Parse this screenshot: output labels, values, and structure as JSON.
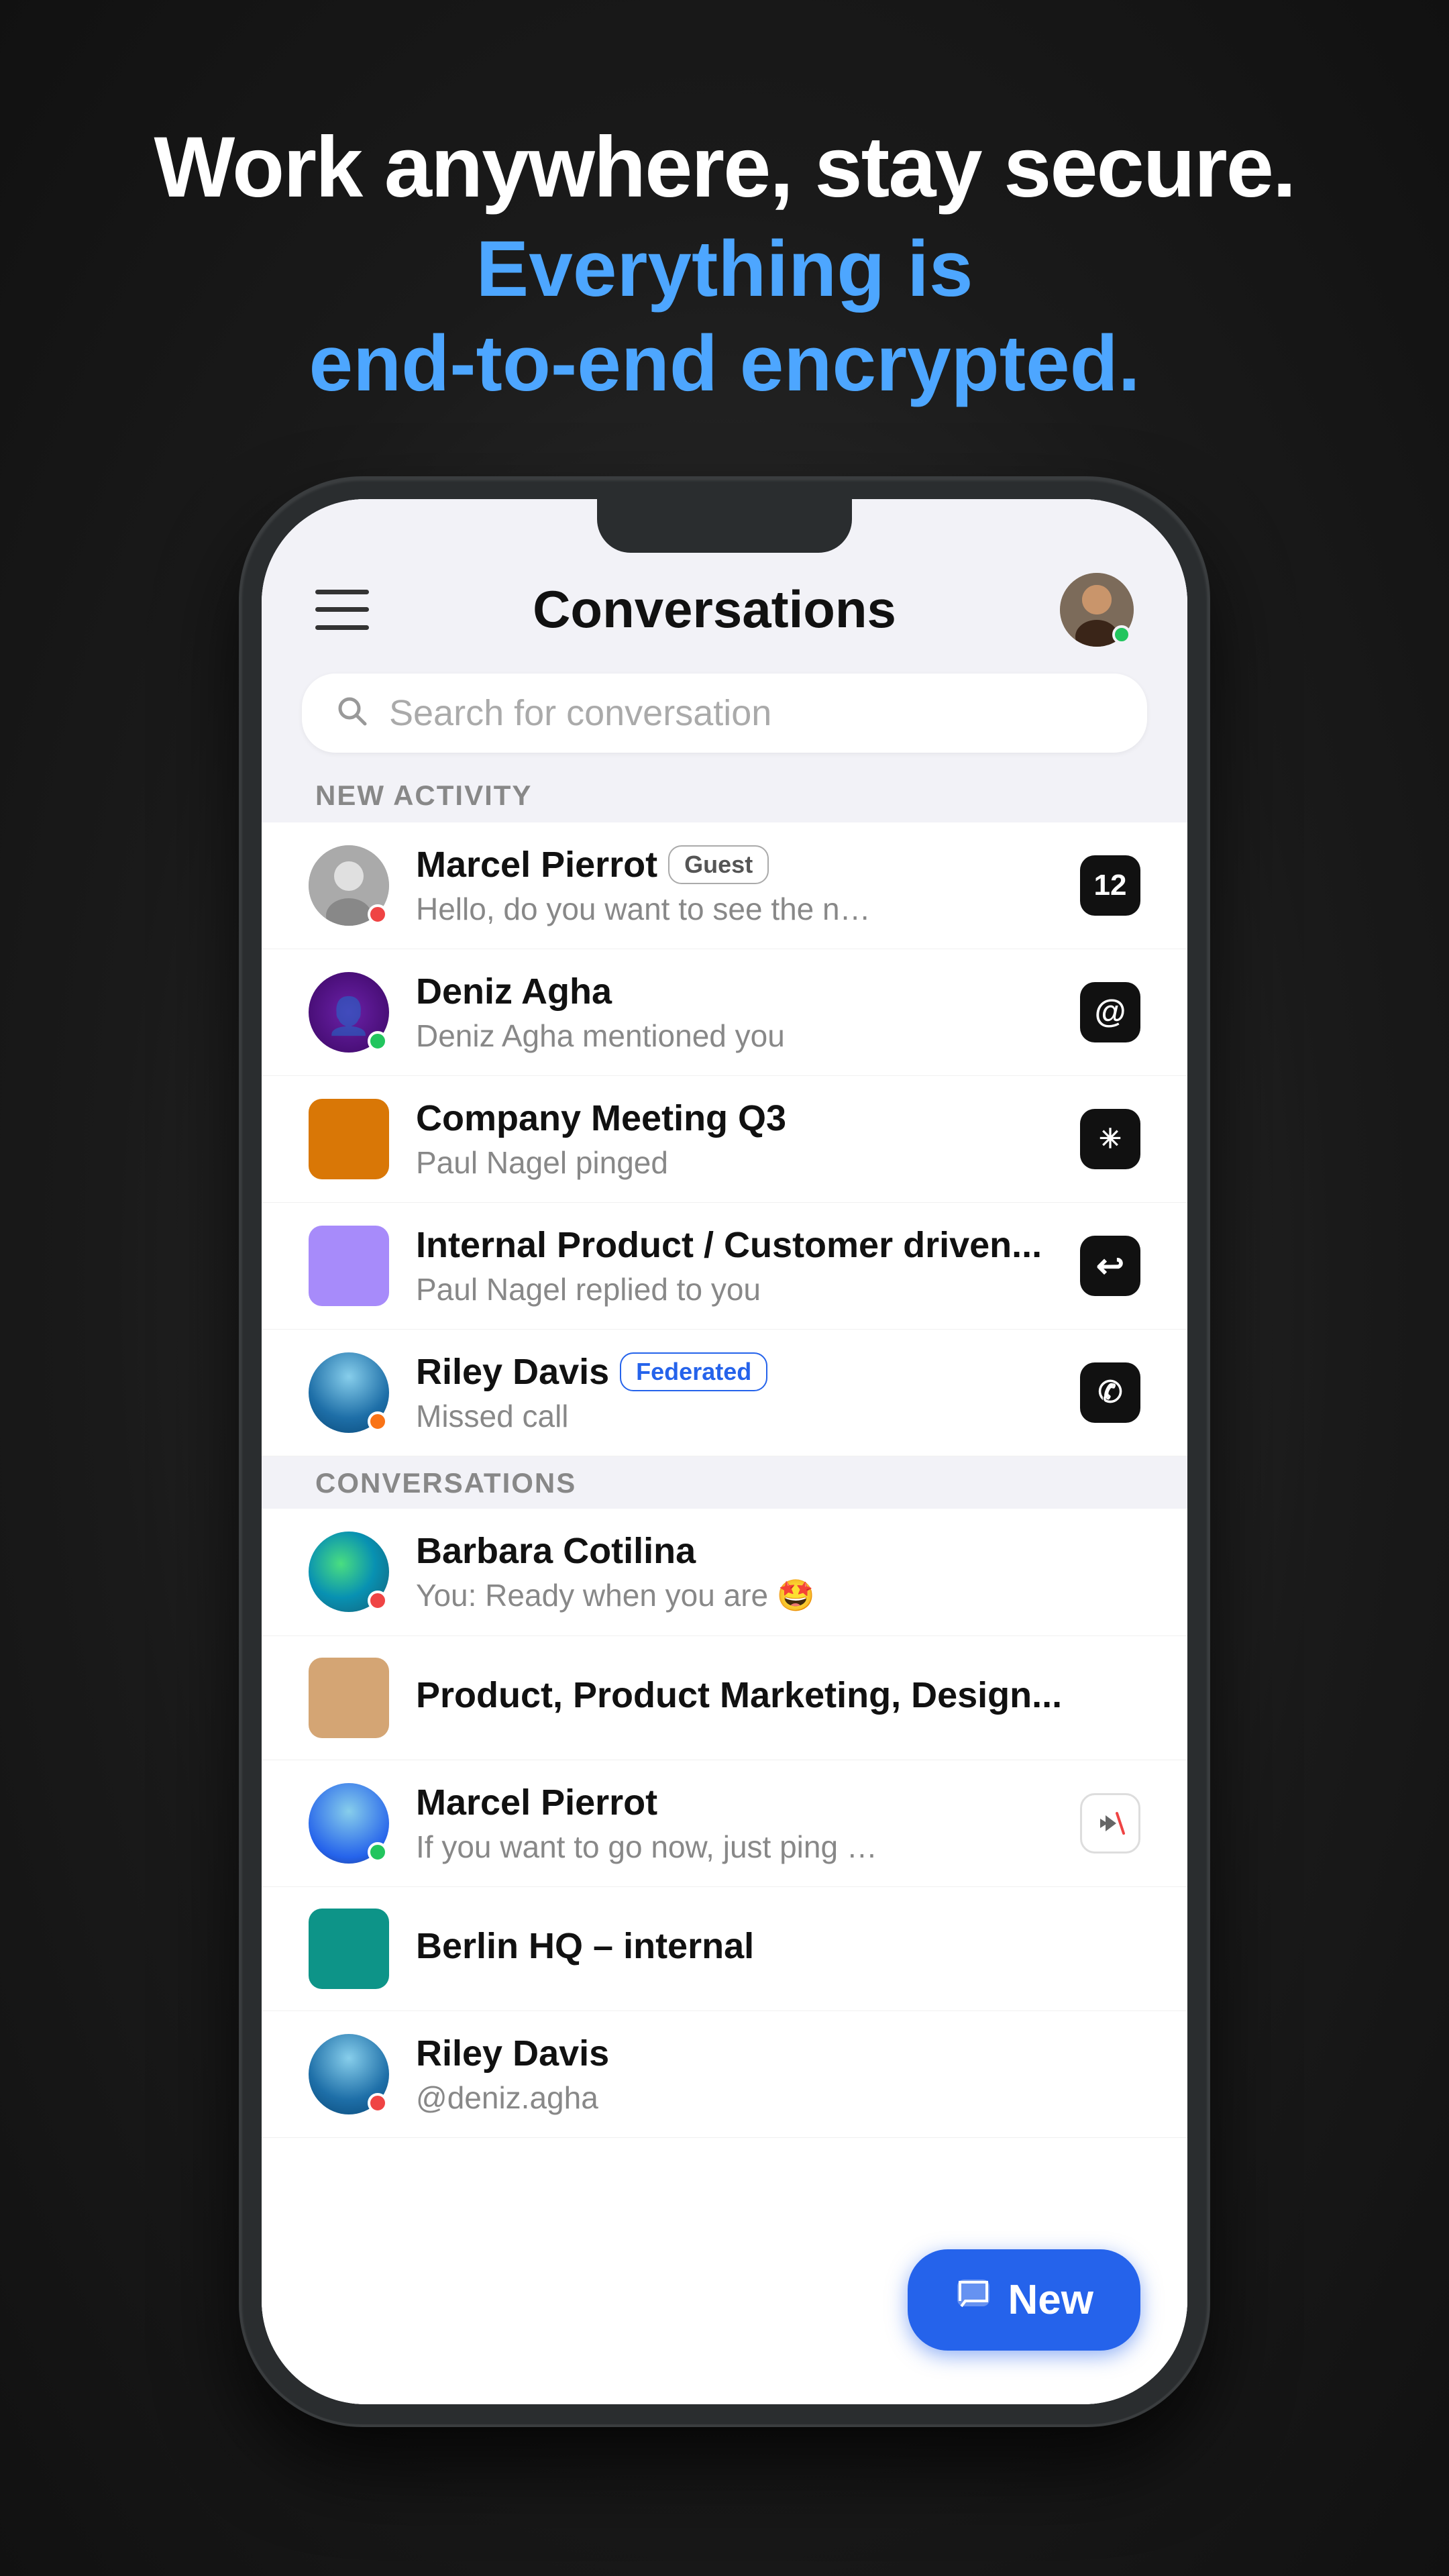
{
  "header": {
    "title": "Work anywhere, stay secure.",
    "subtitle_line1": "Everything is",
    "subtitle_line2": "end-to-end encrypted."
  },
  "topbar": {
    "title": "Conversations"
  },
  "search": {
    "placeholder": "Search for conversation"
  },
  "new_activity_section": {
    "label": "NEW ACTIVITY"
  },
  "conversations_section": {
    "label": "CONVERSATIONS"
  },
  "new_activity_items": [
    {
      "name": "Marcel Pierrot",
      "badge": "Guest",
      "preview": "Hello, do you want to see the number...",
      "action_type": "count",
      "action_value": "12",
      "avatar_type": "person_gray",
      "status": "none"
    },
    {
      "name": "Deniz Agha",
      "badge": "",
      "preview": "Deniz Agha mentioned you",
      "action_type": "mention",
      "action_value": "@",
      "avatar_type": "purple_dark",
      "status": "green"
    },
    {
      "name": "Company Meeting Q3",
      "badge": "",
      "preview": "Paul Nagel pinged",
      "action_type": "ping",
      "action_value": "✳",
      "avatar_type": "orange_square",
      "status": "none"
    },
    {
      "name": "Internal Product / Customer driven...",
      "badge": "",
      "preview": "Paul Nagel replied to you",
      "action_type": "reply",
      "action_value": "↩",
      "avatar_type": "lavender_square",
      "status": "none"
    },
    {
      "name": "Riley Davis",
      "badge": "Federated",
      "preview": "Missed call",
      "action_type": "call",
      "action_value": "✆",
      "avatar_type": "blue_ocean",
      "status": "orange"
    }
  ],
  "conversations_items": [
    {
      "name": "Barbara Cotilina",
      "preview": "You: Ready when you are 🤩",
      "avatar_type": "sea_green",
      "status": "red"
    },
    {
      "name": "Product, Product Marketing, Design...",
      "preview": "",
      "avatar_type": "tan_square",
      "status": "none"
    },
    {
      "name": "Marcel Pierrot",
      "preview": "If you want to go now, just ping me",
      "avatar_type": "mountain",
      "status": "green",
      "has_mute": true
    },
    {
      "name": "Berlin HQ – internal",
      "preview": "",
      "avatar_type": "teal_square",
      "status": "none"
    },
    {
      "name": "Riley Davis",
      "preview": "@deniz.agha",
      "avatar_type": "sea2",
      "status": "red"
    }
  ],
  "fab": {
    "label": "New"
  }
}
